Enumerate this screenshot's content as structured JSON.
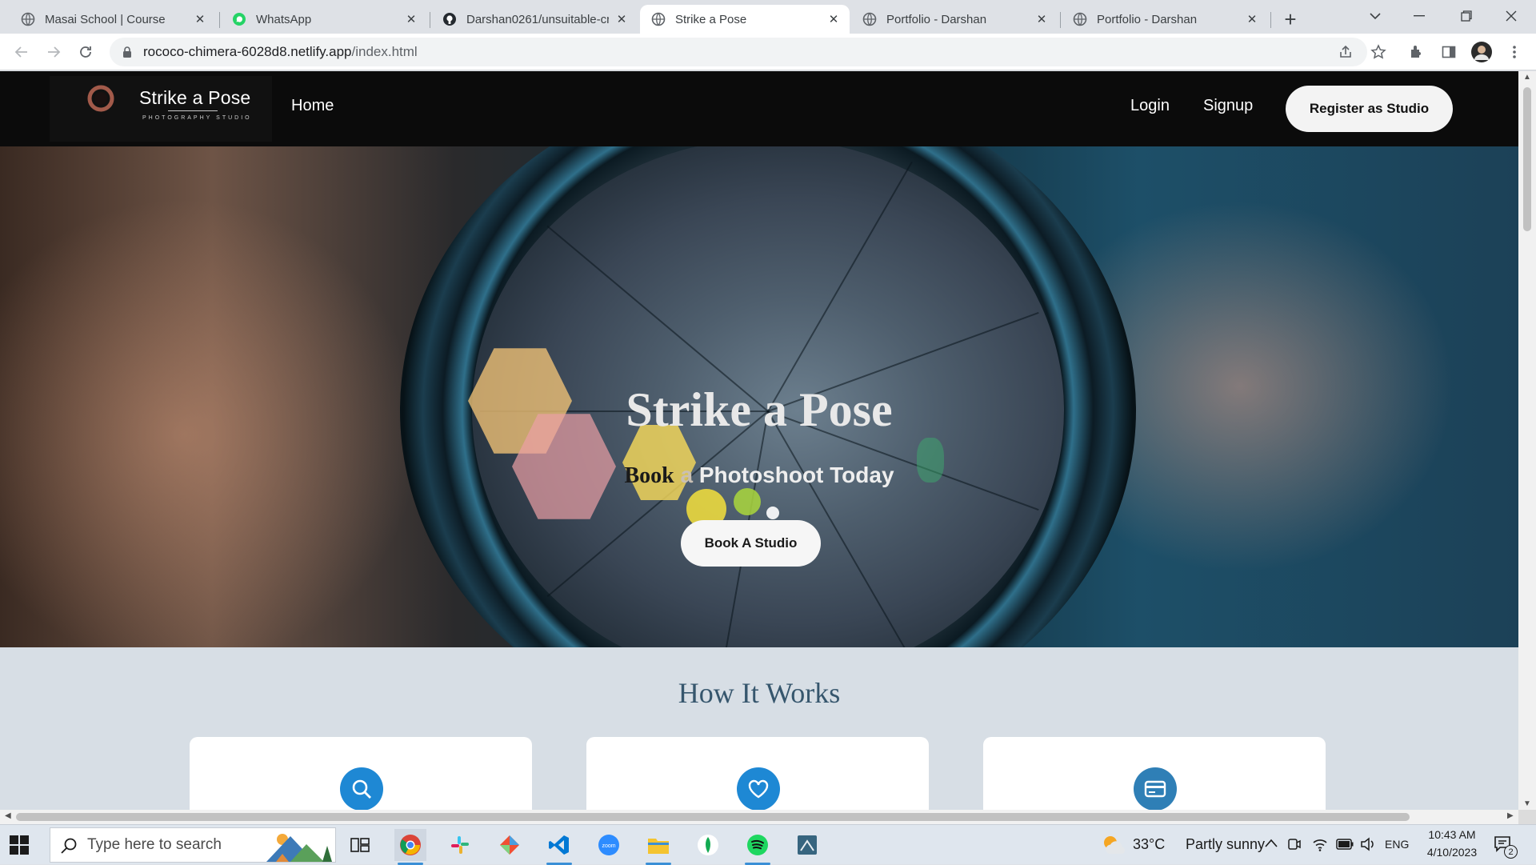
{
  "browser": {
    "tabs": [
      {
        "title": "Masai School | Course",
        "icon": "globe-icon",
        "active": false
      },
      {
        "title": "WhatsApp",
        "icon": "whatsapp-icon",
        "active": false
      },
      {
        "title": "Darshan0261/unsuitable-cr",
        "icon": "github-icon",
        "active": false
      },
      {
        "title": "Strike a Pose",
        "icon": "globe-icon",
        "active": true
      },
      {
        "title": "Portfolio - Darshan",
        "icon": "globe-icon",
        "active": false
      },
      {
        "title": "Portfolio - Darshan",
        "icon": "globe-icon",
        "active": false
      }
    ],
    "url_host": "rococo-chimera-6028d8.netlify.app",
    "url_path": "/index.html"
  },
  "site": {
    "brand": "Strike a Pose",
    "brand_sub": "PHOTOGRAPHY STUDIO",
    "logo_script": "Strike a Pose",
    "nav": {
      "home": "Home",
      "login": "Login",
      "signup": "Signup",
      "register": "Register as Studio"
    },
    "hero": {
      "title": "Strike a Pose",
      "subtitle_book": "Book",
      "subtitle_a": " a",
      "subtitle_rest": " Photoshoot Today",
      "cta": "Book A Studio"
    },
    "how_it_works": {
      "title": "How It Works",
      "cards": [
        {
          "icon": "search-icon"
        },
        {
          "icon": "heart-icon"
        },
        {
          "icon": "card-icon"
        }
      ]
    }
  },
  "taskbar": {
    "search_placeholder": "Type here to search",
    "weather_temp": "33°C",
    "weather_text": "Partly sunny",
    "lang": "ENG",
    "time": "10:43 AM",
    "date": "4/10/2023",
    "notif_count": "2"
  },
  "colors": {
    "accent_blue": "#1e88d4",
    "nav_bg": "#0b0b0b",
    "section_bg": "#d7dee5",
    "heading_blue": "#36566d"
  }
}
